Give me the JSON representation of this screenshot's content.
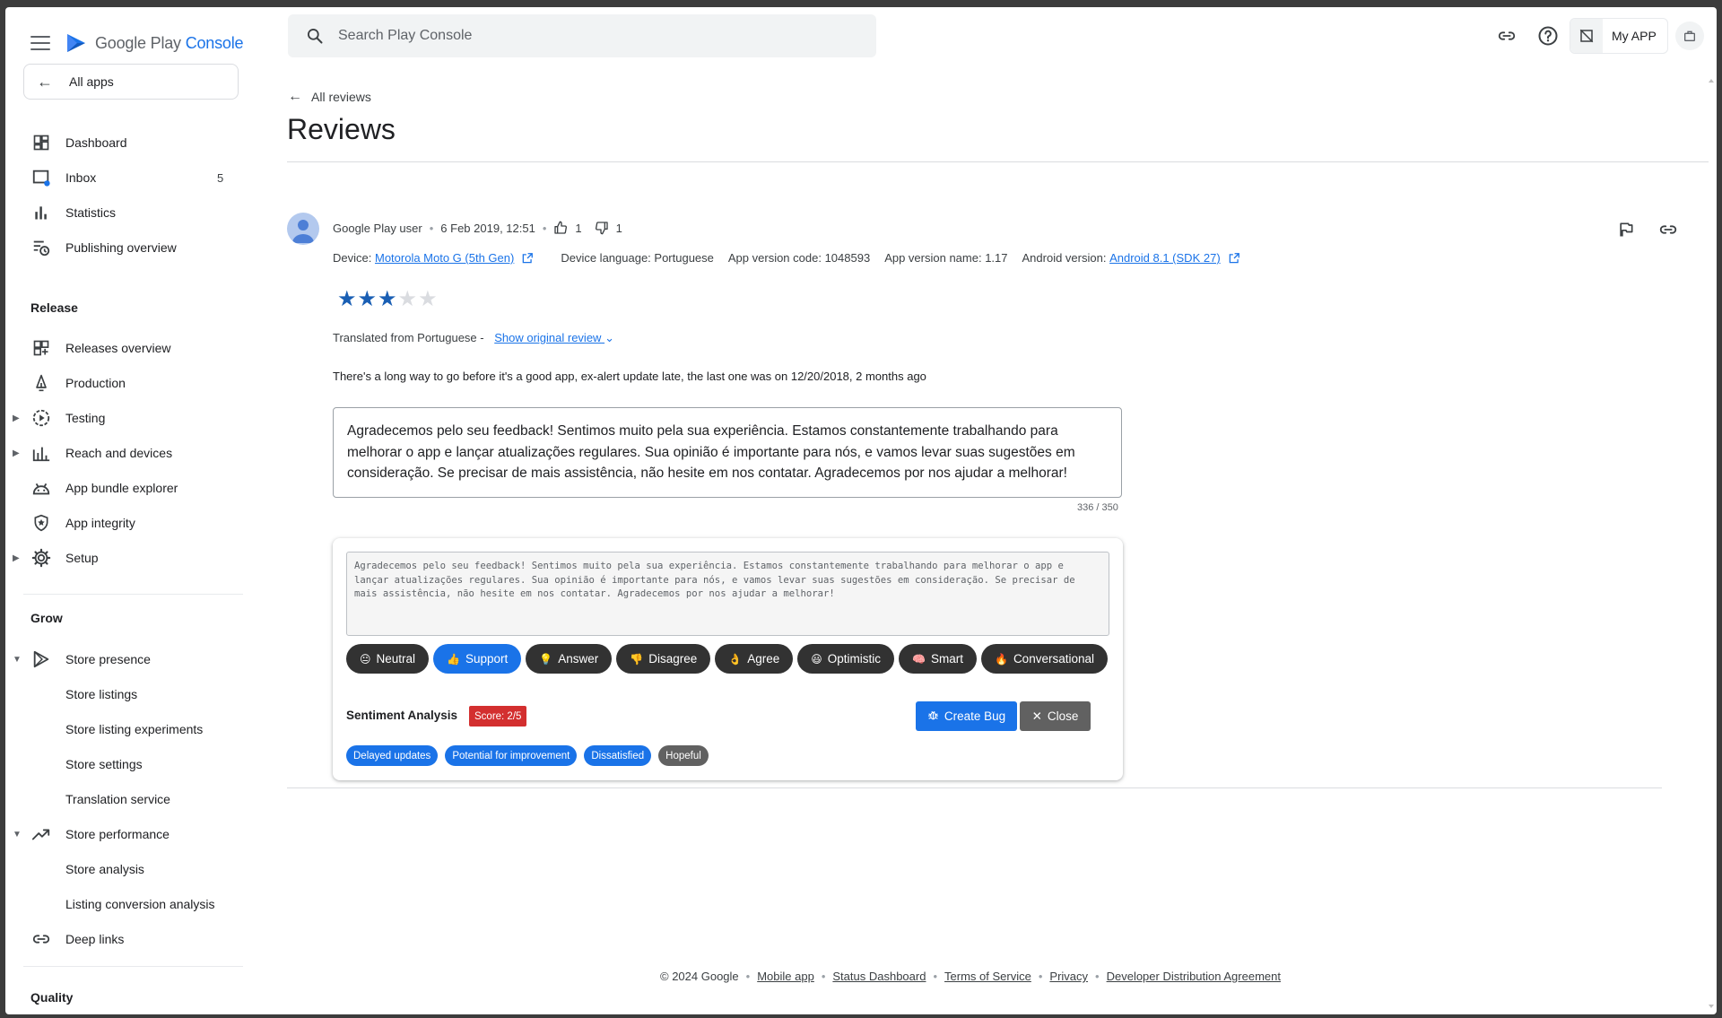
{
  "app": {
    "brand_prefix": "Google Play",
    "brand_accent": "Console",
    "all_apps": "All apps",
    "search_placeholder": "Search Play Console",
    "app_name": "My APP"
  },
  "sidebar": {
    "top_items": [
      {
        "label": "Dashboard",
        "icon": "dashboard-icon"
      },
      {
        "label": "Inbox",
        "icon": "inbox-icon",
        "badge": "5"
      },
      {
        "label": "Statistics",
        "icon": "bar-chart-icon"
      },
      {
        "label": "Publishing overview",
        "icon": "publishing-icon"
      }
    ],
    "release_title": "Release",
    "release_items": [
      {
        "label": "Releases overview",
        "icon": "releases-icon"
      },
      {
        "label": "Production",
        "icon": "production-icon"
      },
      {
        "label": "Testing",
        "icon": "testing-icon"
      },
      {
        "label": "Reach and devices",
        "icon": "reach-icon"
      },
      {
        "label": "App bundle explorer",
        "icon": "bundle-icon"
      },
      {
        "label": "App integrity",
        "icon": "shield-icon"
      },
      {
        "label": "Setup",
        "icon": "gear-icon"
      }
    ],
    "grow_title": "Grow",
    "grow_items": [
      {
        "label": "Store presence",
        "icon": "play-icon"
      },
      {
        "label": "Store listings"
      },
      {
        "label": "Store listing experiments"
      },
      {
        "label": "Store settings"
      },
      {
        "label": "Translation service"
      },
      {
        "label": "Store performance",
        "icon": "trending-icon"
      },
      {
        "label": "Store analysis"
      },
      {
        "label": "Listing conversion analysis"
      },
      {
        "label": "Deep links",
        "icon": "link-icon"
      }
    ],
    "quality_title": "Quality"
  },
  "page": {
    "breadcrumb": "All reviews",
    "title": "Reviews"
  },
  "review": {
    "author": "Google Play user",
    "date": "6 Feb 2019, 12:51",
    "thumbs_up": "1",
    "thumbs_down": "1",
    "device_label": "Device:",
    "device_value": "Motorola Moto G (5th Gen)",
    "language": "Device language: Portuguese",
    "version_code": "App version code: 1048593",
    "version_name": "App version name: 1.17",
    "android_label": "Android version:",
    "android_value": "Android 8.1 (SDK 27)",
    "rating": 3,
    "rating_max": 5,
    "translated_text": "Translated from Portuguese -",
    "show_original": "Show original review",
    "text": "There's a long way to go before it's a good app, ex-alert update late, the last one was on 12/20/2018, 2 months ago"
  },
  "reply": {
    "value": "Agradecemos pelo seu feedback! Sentimos muito pela sua experiência. Estamos constantemente trabalhando para melhorar o app e lançar atualizações regulares. Sua opinião é importante para nós, e vamos levar suas sugestões em consideração. Se precisar de mais assistência, não hesite em nos contatar. Agradecemos por nos ajudar a melhorar!",
    "counter": "336 / 350"
  },
  "assistant": {
    "draft": "Agradecemos pelo seu feedback! Sentimos muito pela sua experiência. Estamos constantemente trabalhando para melhorar o app e lançar atualizações regulares. Sua opinião é importante para nós, e vamos levar suas sugestões em consideração. Se precisar de mais assistência, não hesite em nos contatar. Agradecemos por nos ajudar a melhorar!",
    "tones": [
      {
        "label": "Neutral",
        "emoji": "😐"
      },
      {
        "label": "Support",
        "emoji": "👍",
        "active": true
      },
      {
        "label": "Answer",
        "emoji": "💡"
      },
      {
        "label": "Disagree",
        "emoji": "👎"
      },
      {
        "label": "Agree",
        "emoji": "👌"
      },
      {
        "label": "Optimistic",
        "emoji": "😃"
      },
      {
        "label": "Smart",
        "emoji": "🧠"
      },
      {
        "label": "Conversational",
        "emoji": "🔥"
      }
    ],
    "sentiment_label": "Sentiment Analysis",
    "score": "Score: 2/5",
    "create_bug": "Create Bug",
    "close": "Close",
    "tags": [
      {
        "label": "Delayed updates",
        "color": "blue"
      },
      {
        "label": "Potential for improvement",
        "color": "blue"
      },
      {
        "label": "Dissatisfied",
        "color": "blue"
      },
      {
        "label": "Hopeful",
        "color": "gray"
      }
    ]
  },
  "footer": {
    "copyright": "© 2024 Google",
    "links": [
      "Mobile app",
      "Status Dashboard",
      "Terms of Service",
      "Privacy",
      "Developer Distribution Agreement"
    ]
  },
  "colors": {
    "accent": "#1a73e8",
    "star": "#1a5fb4",
    "star_empty": "#dadce0",
    "score_red": "#d32f2f"
  }
}
